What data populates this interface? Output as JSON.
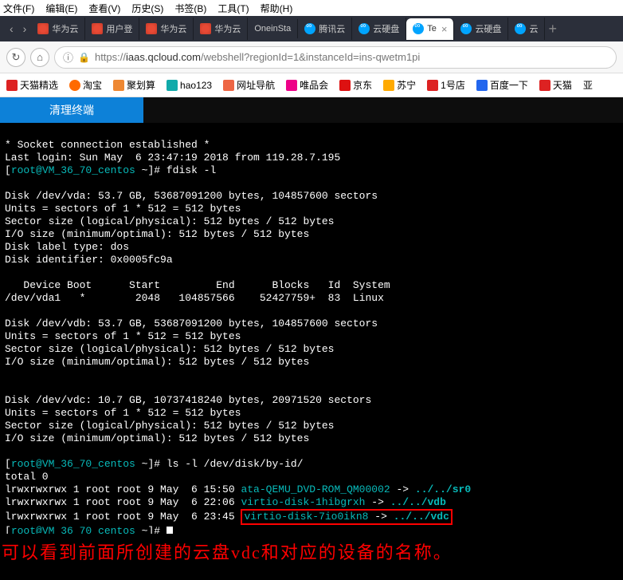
{
  "menu": {
    "file": "文件(F)",
    "edit": "编辑(E)",
    "view": "查看(V)",
    "history": "历史(S)",
    "bookmarks": "书签(B)",
    "tools": "工具(T)",
    "help": "帮助(H)"
  },
  "tabs": [
    {
      "label": "华为云",
      "icon": "huawei"
    },
    {
      "label": "用户登",
      "icon": "huawei"
    },
    {
      "label": "华为云",
      "icon": "huawei"
    },
    {
      "label": "华为云",
      "icon": "huawei"
    },
    {
      "label": "OneinSta",
      "icon": "none"
    },
    {
      "label": "腾讯云",
      "icon": "tencent"
    },
    {
      "label": "云硬盘",
      "icon": "tencent"
    },
    {
      "label": "Te",
      "icon": "tencent",
      "active": true
    },
    {
      "label": "云硬盘",
      "icon": "tencent"
    },
    {
      "label": "云",
      "icon": "tencent"
    }
  ],
  "url": {
    "prefix": "https://",
    "domain": "iaas.qcloud.com",
    "path": "/webshell?regionId=1&instanceId=ins-qwetm1pi"
  },
  "bookmarks": [
    {
      "label": "天猫精选",
      "ico": "bm-tmall"
    },
    {
      "label": "淘宝",
      "ico": "bm-taobao"
    },
    {
      "label": "聚划算",
      "ico": "bm-juhua"
    },
    {
      "label": "hao123",
      "ico": "bm-hao"
    },
    {
      "label": "网址导航",
      "ico": "bm-nav"
    },
    {
      "label": "唯品会",
      "ico": "bm-vip"
    },
    {
      "label": "京东",
      "ico": "bm-jd"
    },
    {
      "label": "苏宁",
      "ico": "bm-sn"
    },
    {
      "label": "1号店",
      "ico": "bm-1hd"
    },
    {
      "label": "百度一下",
      "ico": "bm-baidu"
    },
    {
      "label": "天猫",
      "ico": "bm-tmall2"
    },
    {
      "label": "亚",
      "ico": ""
    }
  ],
  "header": {
    "clear": "清理终端"
  },
  "term": {
    "l00": "",
    "l01": "* Socket connection established *",
    "l02": "Last login: Sun May  6 23:47:19 2018 from 119.28.7.195",
    "p1u": "root@VM_36_70_centos",
    "p1t": "~",
    "cmd1": "fdisk -l",
    "l03": "",
    "l04": "Disk /dev/vda: 53.7 GB, 53687091200 bytes, 104857600 sectors",
    "l05": "Units = sectors of 1 * 512 = 512 bytes",
    "l06": "Sector size (logical/physical): 512 bytes / 512 bytes",
    "l07": "I/O size (minimum/optimal): 512 bytes / 512 bytes",
    "l08": "Disk label type: dos",
    "l09": "Disk identifier: 0x0005fc9a",
    "l10": "",
    "l11": "   Device Boot      Start         End      Blocks   Id  System",
    "l12": "/dev/vda1   *        2048   104857566    52427759+  83  Linux",
    "l13": "",
    "l14": "Disk /dev/vdb: 53.7 GB, 53687091200 bytes, 104857600 sectors",
    "l15": "Units = sectors of 1 * 512 = 512 bytes",
    "l16": "Sector size (logical/physical): 512 bytes / 512 bytes",
    "l17": "I/O size (minimum/optimal): 512 bytes / 512 bytes",
    "l18": "",
    "l19": "",
    "l20": "Disk /dev/vdc: 10.7 GB, 10737418240 bytes, 20971520 sectors",
    "l21": "Units = sectors of 1 * 512 = 512 bytes",
    "l22": "Sector size (logical/physical): 512 bytes / 512 bytes",
    "l23": "I/O size (minimum/optimal): 512 bytes / 512 bytes",
    "l24": "",
    "p2u": "root@VM_36_70_centos",
    "p2t": "~",
    "cmd2": "ls -l /dev/disk/by-id/",
    "l25": "total 0",
    "ls1_a": "lrwxrwxrwx 1 root root 9 May  6 15:50 ",
    "ls1_b": "ata-QEMU_DVD-ROM_QM00002",
    "ls1_c": " -> ",
    "ls1_d": "../../sr0",
    "ls2_a": "lrwxrwxrwx 1 root root 9 May  6 22:06 ",
    "ls2_b": "virtio-disk-1hibgrxh",
    "ls2_c": " -> ",
    "ls2_d": "../../vdb",
    "ls3_a": "lrwxrwxrwx 1 root root 9 May  6 23:45 ",
    "ls3_b": "virtio-disk-7io0ikn8",
    "ls3_c": " -> ",
    "ls3_d": "../../vdc",
    "p3u": "root@VM_36_70_centos",
    "p3t": "~"
  },
  "annotation": "可以看到前面所创建的云盘vdc和对应的设备的名称。"
}
